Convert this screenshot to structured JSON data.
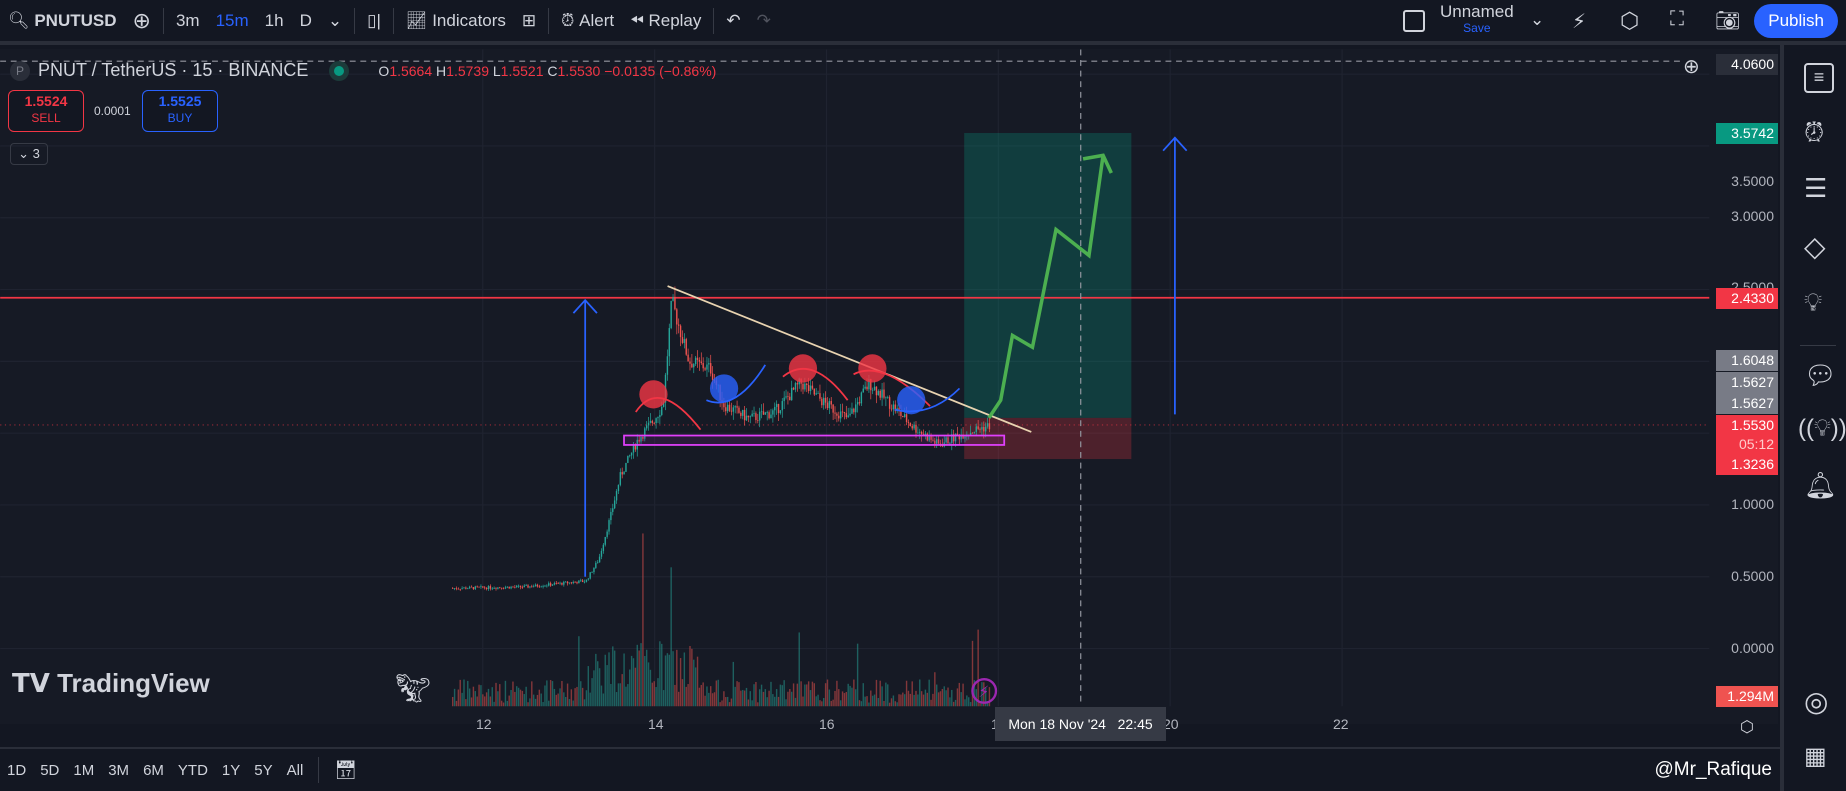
{
  "toolbar": {
    "symbol": "PNUTUSD",
    "intervals": [
      "3m",
      "15m",
      "1h",
      "D"
    ],
    "active_interval": "15m",
    "indicators": "Indicators",
    "alert": "Alert",
    "replay": "Replay",
    "layout_name": "Unnamed",
    "save": "Save",
    "publish": "Publish"
  },
  "legend": {
    "title": "PNUT / TetherUS · 15 · BINANCE",
    "logo_letter": "P",
    "o_label": "O",
    "o": "1.5664",
    "h_label": "H",
    "h": "1.5739",
    "l_label": "L",
    "l": "1.5521",
    "c_label": "C",
    "c": "1.5530",
    "change": "−0.0135 (−0.86%)",
    "sell_price": "1.5524",
    "sell": "SELL",
    "spread": "0.0001",
    "buy_price": "1.5525",
    "buy": "BUY",
    "collapse_count": "3"
  },
  "price_axis": {
    "ticks": [
      "3.5000",
      "3.0000",
      "2.5000",
      "1.0000",
      "0.5000",
      "0.0000"
    ],
    "top_label": "4.0600",
    "target": "3.5742",
    "resistance": "2.4330",
    "l1": "1.6048",
    "l2": "1.5627",
    "l3": "1.5627",
    "last": "1.5530",
    "countdown": "05:12",
    "stop": "1.3236",
    "volume": "1.294M"
  },
  "time_axis": {
    "ticks": [
      "12",
      "14",
      "16",
      "18",
      "20",
      "22"
    ],
    "crosshair_label": "Mon 18 Nov '24   22:45"
  },
  "branding": "TradingView",
  "bottom": {
    "ranges": [
      "1D",
      "5D",
      "1M",
      "3M",
      "6M",
      "YTD",
      "1Y",
      "5Y",
      "All"
    ],
    "watermark": "@Mr_Rafique"
  },
  "colors": {
    "up": "#26a69a",
    "down": "#ef5350",
    "accent": "#2962ff",
    "resistance": "#f23645",
    "target": "#089981"
  },
  "chart_data": {
    "type": "candlestick",
    "price_path": [
      [
        11.65,
        0.42
      ],
      [
        12.5,
        0.43
      ],
      [
        13.2,
        0.47
      ],
      [
        13.35,
        0.62
      ],
      [
        13.5,
        0.95
      ],
      [
        13.6,
        1.2
      ],
      [
        13.8,
        1.45
      ],
      [
        14.0,
        1.6
      ],
      [
        14.1,
        1.7
      ],
      [
        14.2,
        2.42
      ],
      [
        14.4,
        2.0
      ],
      [
        14.65,
        1.95
      ],
      [
        14.8,
        1.7
      ],
      [
        15.1,
        1.6
      ],
      [
        15.4,
        1.65
      ],
      [
        15.7,
        1.85
      ],
      [
        16.0,
        1.7
      ],
      [
        16.25,
        1.6
      ],
      [
        16.5,
        1.85
      ],
      [
        16.75,
        1.7
      ],
      [
        17.0,
        1.55
      ],
      [
        17.3,
        1.42
      ],
      [
        17.6,
        1.5
      ],
      [
        17.9,
        1.553
      ]
    ],
    "resistance": 2.433,
    "target": 3.5742,
    "stop": 1.3236,
    "entry": 1.553
  }
}
